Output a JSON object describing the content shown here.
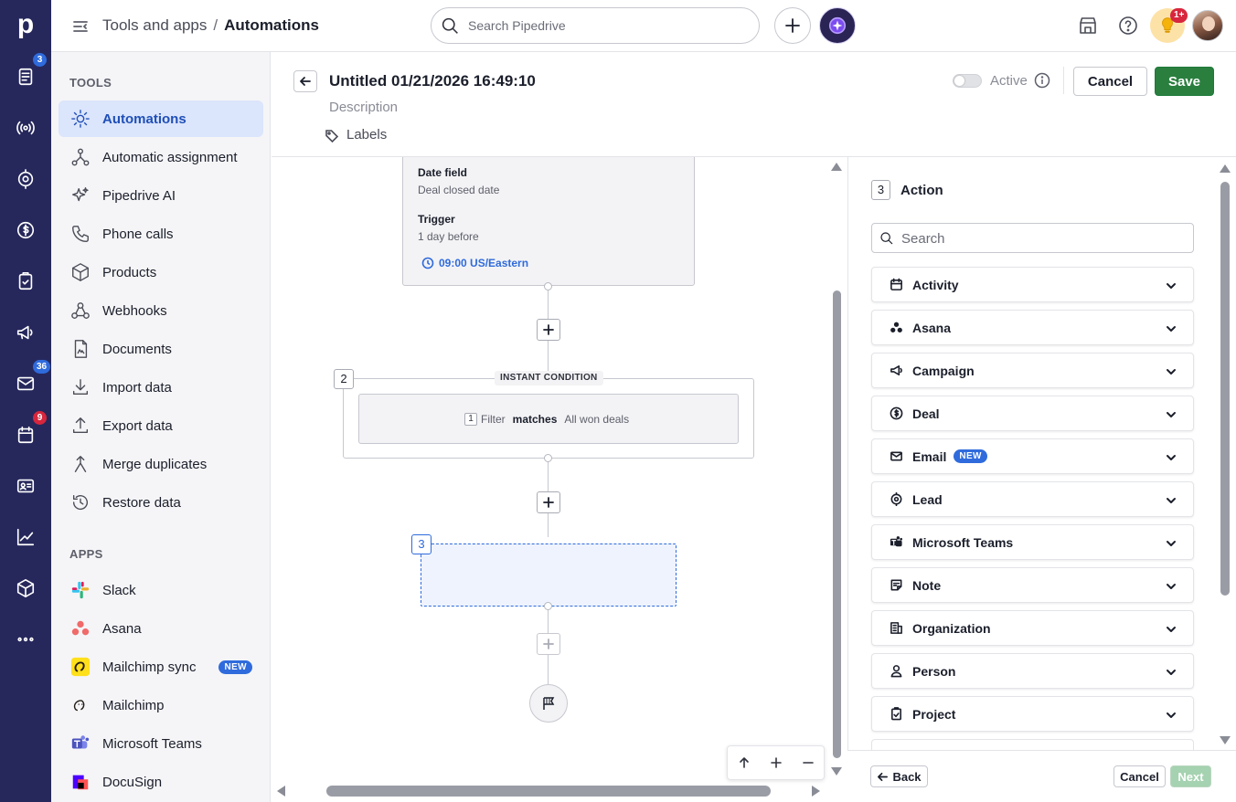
{
  "rail": {
    "logo": "p",
    "items": [
      {
        "icon": "deals-list-icon",
        "badge": "3",
        "badge_color": "#2f6bdc"
      },
      {
        "icon": "broadcast-icon"
      },
      {
        "icon": "target-icon"
      },
      {
        "icon": "dollar-icon"
      },
      {
        "icon": "clipboard-check-icon"
      },
      {
        "icon": "megaphone-icon"
      },
      {
        "icon": "mail-icon",
        "badge": "36",
        "badge_color": "#2f6bdc"
      },
      {
        "icon": "calendar-icon",
        "badge": "9",
        "badge_color": "#d7263d"
      },
      {
        "icon": "contact-card-icon"
      },
      {
        "icon": "chart-icon"
      },
      {
        "icon": "box-icon"
      },
      {
        "icon": "more-icon"
      }
    ]
  },
  "header": {
    "breadcrumb_parent": "Tools and apps",
    "breadcrumb_sep": "/",
    "breadcrumb_current": "Automations",
    "search_placeholder": "Search Pipedrive",
    "notifications_badge": "1+"
  },
  "sidemenu": {
    "tools_heading": "TOOLS",
    "tools": [
      {
        "label": "Automations",
        "icon": "automations-icon",
        "active": true
      },
      {
        "label": "Automatic assignment",
        "icon": "assignment-icon"
      },
      {
        "label": "Pipedrive AI",
        "icon": "sparkle-icon"
      },
      {
        "label": "Phone calls",
        "icon": "phone-icon"
      },
      {
        "label": "Products",
        "icon": "box-icon"
      },
      {
        "label": "Webhooks",
        "icon": "webhook-icon"
      },
      {
        "label": "Documents",
        "icon": "document-icon"
      },
      {
        "label": "Import data",
        "icon": "import-icon"
      },
      {
        "label": "Export data",
        "icon": "export-icon"
      },
      {
        "label": "Merge duplicates",
        "icon": "merge-icon"
      },
      {
        "label": "Restore data",
        "icon": "restore-icon"
      }
    ],
    "apps_heading": "APPS",
    "apps": [
      {
        "label": "Slack",
        "icon": "slack-logo-icon"
      },
      {
        "label": "Asana",
        "icon": "asana-logo-icon"
      },
      {
        "label": "Mailchimp sync",
        "icon": "mailchimp-logo-icon",
        "tag": "NEW"
      },
      {
        "label": "Mailchimp",
        "icon": "mailchimp-logo-icon"
      },
      {
        "label": "Microsoft Teams",
        "icon": "teams-logo-icon"
      },
      {
        "label": "DocuSign",
        "icon": "docusign-logo-icon"
      }
    ]
  },
  "editor": {
    "title": "Untitled 01/21/2026 16:49:10",
    "description_placeholder": "Description",
    "labels_text": "Labels",
    "active_label": "Active",
    "active": false,
    "cancel_label": "Cancel",
    "save_label": "Save"
  },
  "canvas": {
    "trigger_card": {
      "date_field_label": "Date field",
      "date_field_value": "Deal closed date",
      "trigger_label": "Trigger",
      "trigger_value": "1 day before",
      "time_value": "09:00 US/Eastern"
    },
    "condition": {
      "step_number": "2",
      "tag": "INSTANT CONDITION",
      "filter_index": "1",
      "filter_prefix": "Filter",
      "filter_operator": "matches",
      "filter_value": "All won deals"
    },
    "placeholder_step_number": "3"
  },
  "action_panel": {
    "step_number": "3",
    "title": "Action",
    "search_placeholder": "Search",
    "categories": [
      {
        "label": "Activity",
        "icon": "calendar-icon"
      },
      {
        "label": "Asana",
        "icon": "asana-logo-icon"
      },
      {
        "label": "Campaign",
        "icon": "megaphone-icon"
      },
      {
        "label": "Deal",
        "icon": "dollar-icon"
      },
      {
        "label": "Email",
        "icon": "mail-icon",
        "tag": "NEW"
      },
      {
        "label": "Lead",
        "icon": "target-icon"
      },
      {
        "label": "Microsoft Teams",
        "icon": "teams-logo-icon"
      },
      {
        "label": "Note",
        "icon": "note-icon"
      },
      {
        "label": "Organization",
        "icon": "building-icon"
      },
      {
        "label": "Person",
        "icon": "person-icon"
      },
      {
        "label": "Project",
        "icon": "clipboard-check-icon"
      }
    ],
    "back_label": "Back",
    "cancel_label": "Cancel",
    "next_label": "Next"
  },
  "colors": {
    "rail_bg": "#26285c",
    "accent_blue": "#2f6bdc",
    "save_green": "#2a7f3f",
    "active_item_bg": "#dbe5fb"
  }
}
